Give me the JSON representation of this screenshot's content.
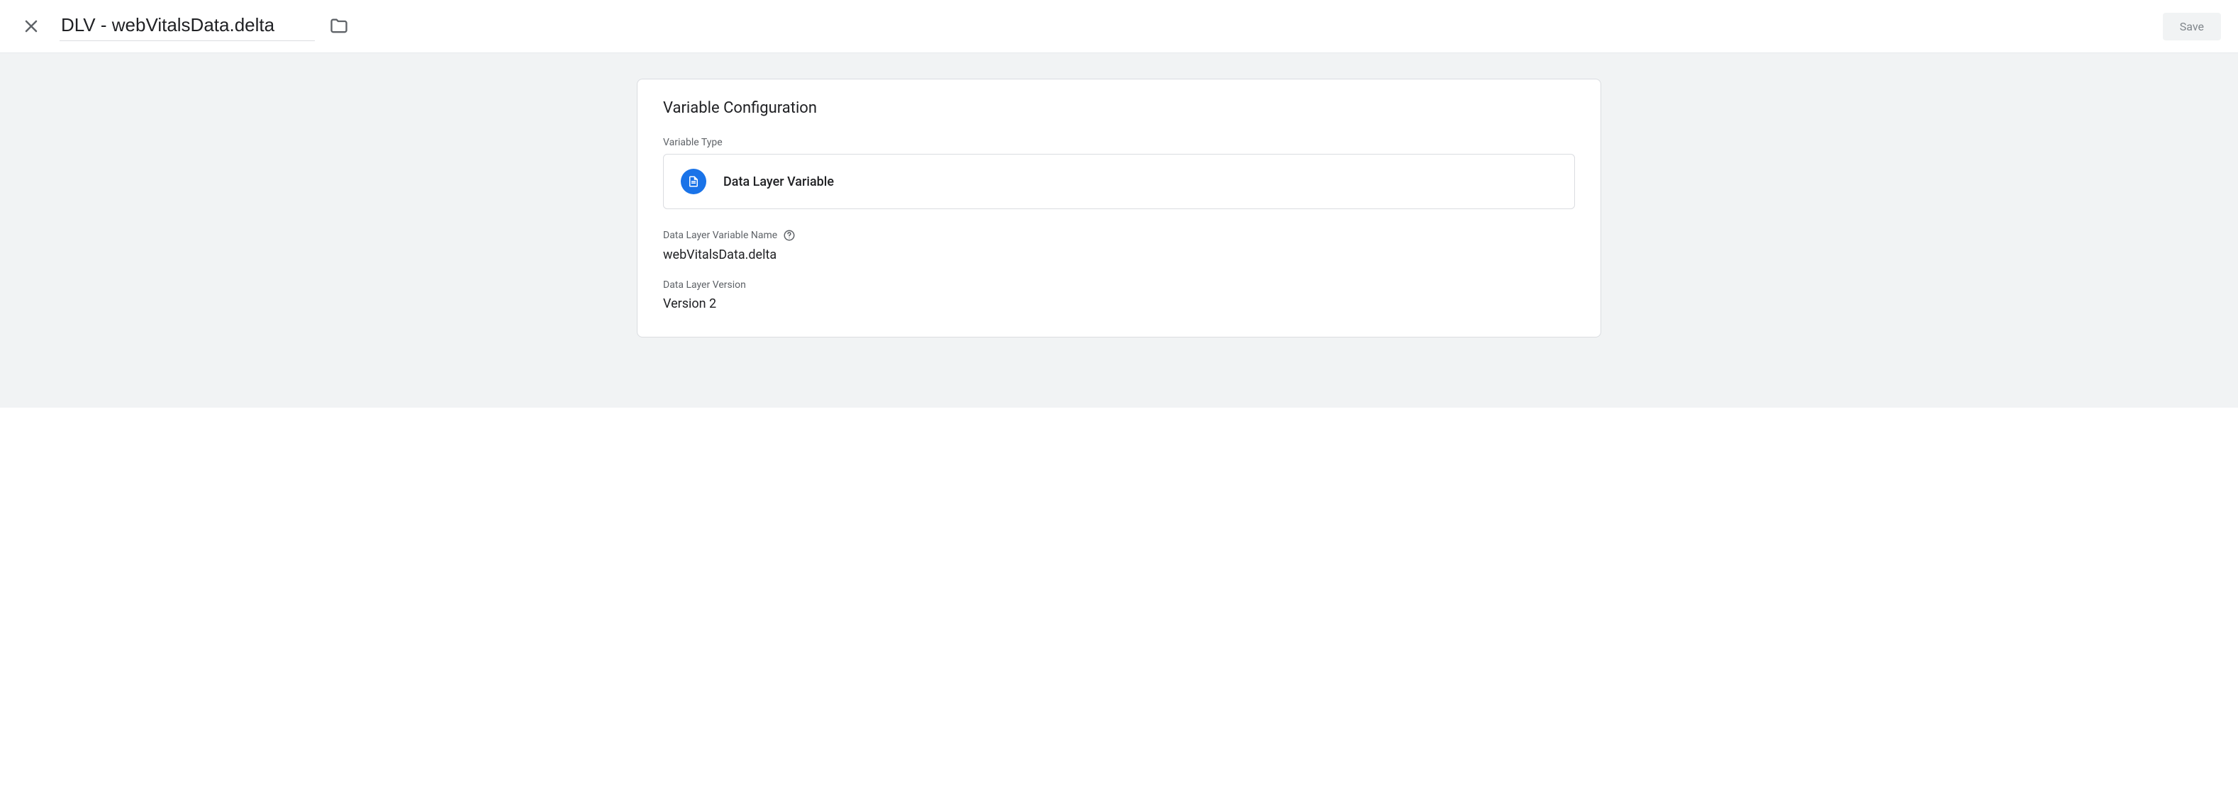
{
  "header": {
    "title": "DLV - webVitalsData.delta",
    "save_label": "Save"
  },
  "card": {
    "title": "Variable Configuration",
    "type_label": "Variable Type",
    "type_value": "Data Layer Variable",
    "name_label": "Data Layer Variable Name",
    "name_value": "webVitalsData.delta",
    "version_label": "Data Layer Version",
    "version_value": "Version 2"
  }
}
